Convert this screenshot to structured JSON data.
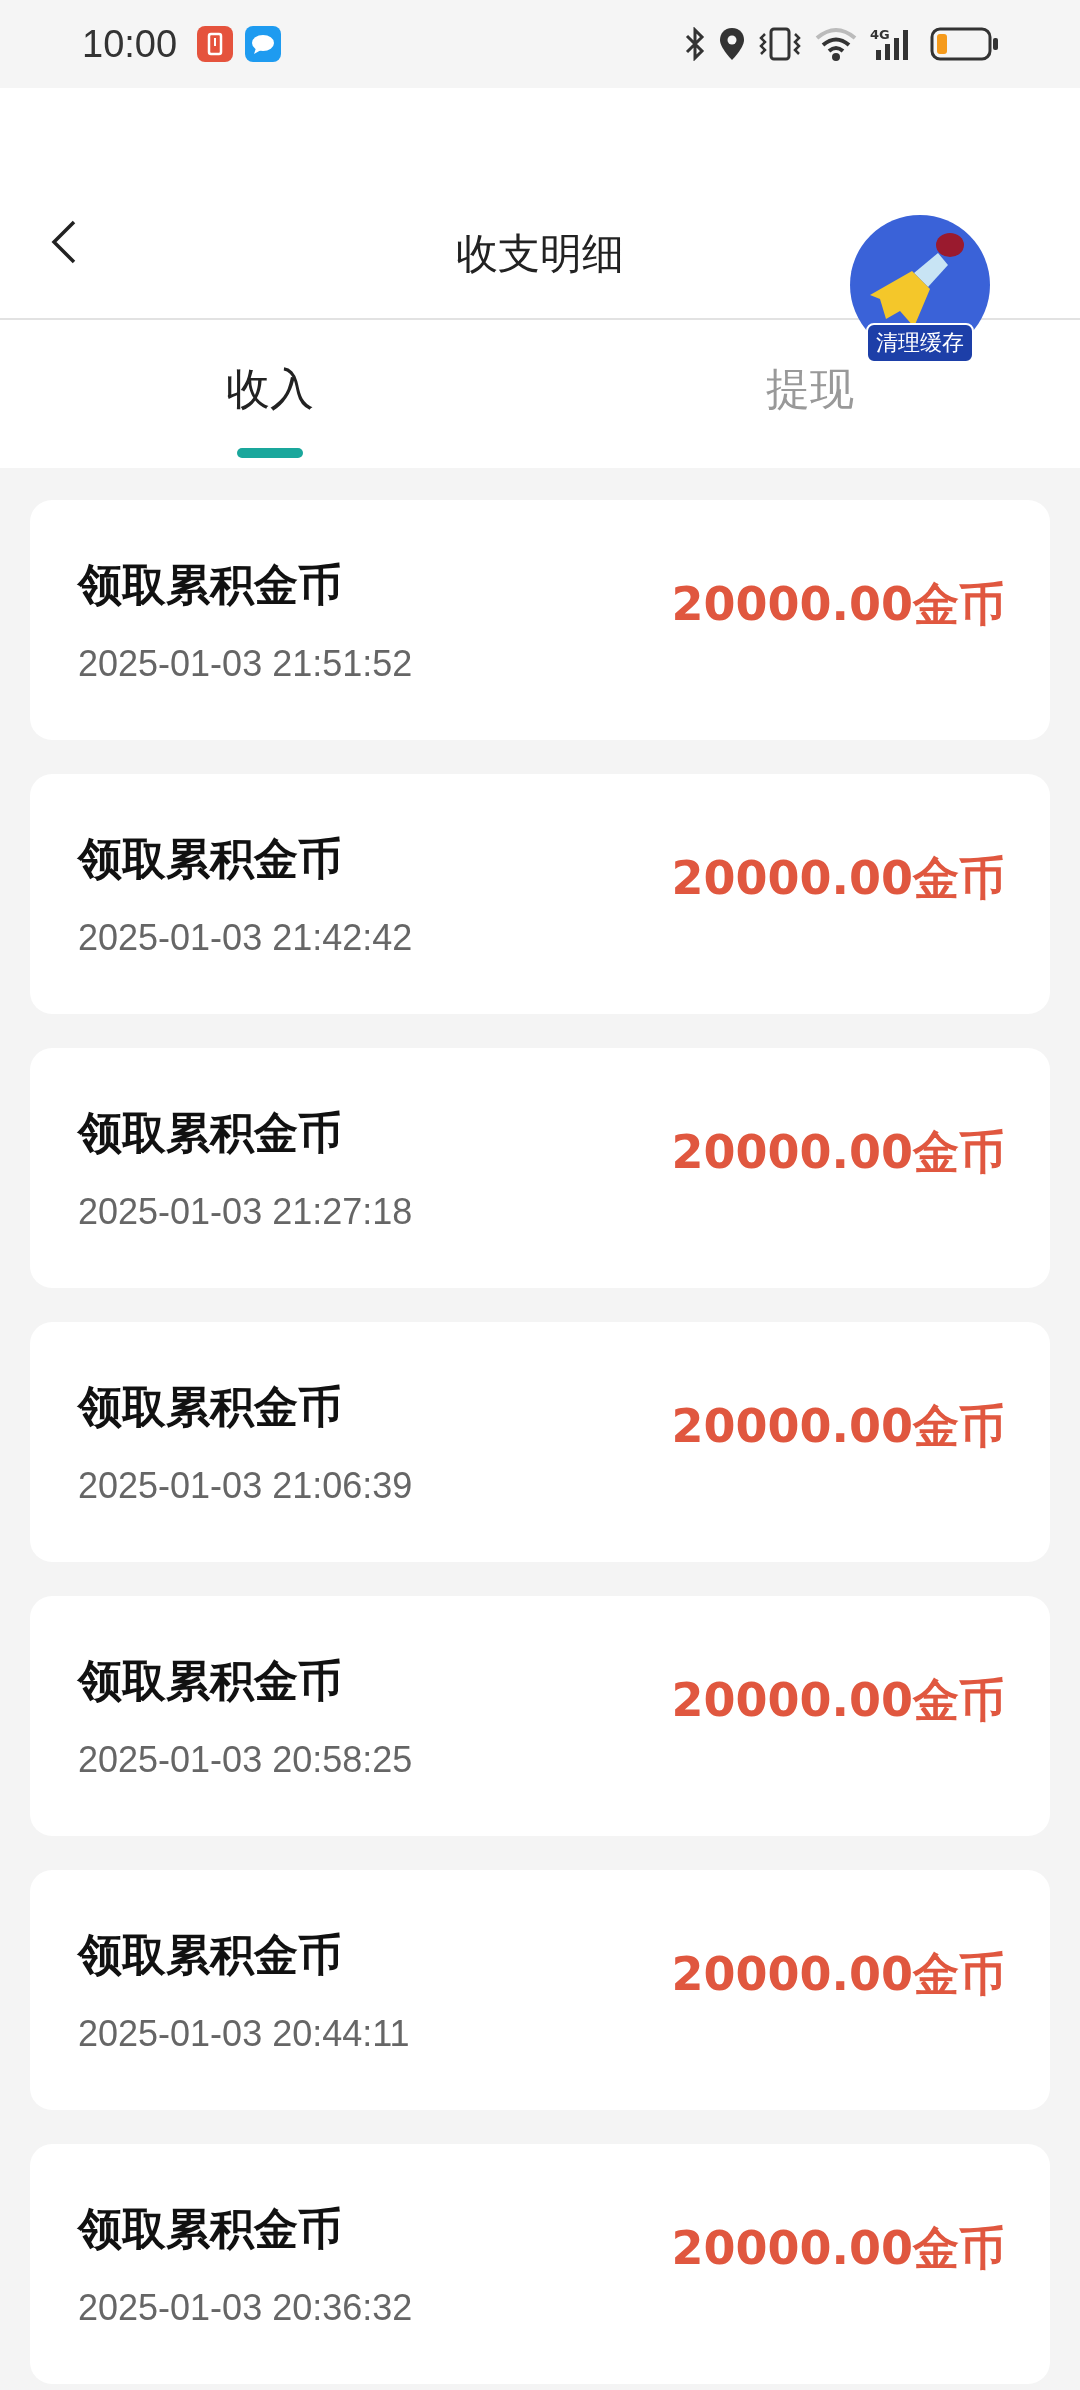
{
  "status_bar": {
    "time": "10:00",
    "network": "4G"
  },
  "header": {
    "title": "收支明细",
    "badge": "清理缓存"
  },
  "tabs": [
    {
      "label": "收入",
      "selected": true
    },
    {
      "label": "提现",
      "selected": false
    }
  ],
  "records": [
    {
      "title": "领取累积金币",
      "time": "2025-01-03 21:51:52",
      "amount": "20000.00金币"
    },
    {
      "title": "领取累积金币",
      "time": "2025-01-03 21:42:42",
      "amount": "20000.00金币"
    },
    {
      "title": "领取累积金币",
      "time": "2025-01-03 21:27:18",
      "amount": "20000.00金币"
    },
    {
      "title": "领取累积金币",
      "time": "2025-01-03 21:06:39",
      "amount": "20000.00金币"
    },
    {
      "title": "领取累积金币",
      "time": "2025-01-03 20:58:25",
      "amount": "20000.00金币"
    },
    {
      "title": "领取累积金币",
      "time": "2025-01-03 20:44:11",
      "amount": "20000.00金币"
    },
    {
      "title": "领取累积金币",
      "time": "2025-01-03 20:36:32",
      "amount": "20000.00金币"
    }
  ]
}
